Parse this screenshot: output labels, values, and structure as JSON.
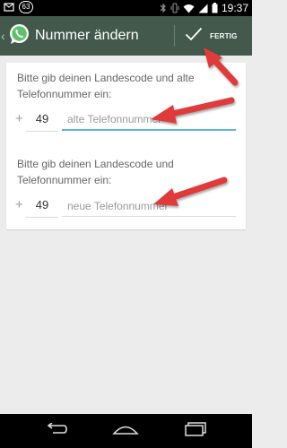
{
  "status_bar": {
    "notification_count": "63",
    "time": "19:37"
  },
  "action_bar": {
    "title": "Nummer ändern",
    "done_label": "FERTIG"
  },
  "form": {
    "old_number": {
      "instruction": "Bitte gib deinen Landescode und alte Telefonnummer ein:",
      "plus": "+",
      "country_code": "49",
      "placeholder": "alte Telefonnummer"
    },
    "new_number": {
      "instruction": "Bitte gib deinen Landescode und Telefonnummer ein:",
      "plus": "+",
      "country_code": "49",
      "placeholder": "neue Telefonnummer"
    }
  },
  "annotations": {
    "arrow_color": "#e03a3a"
  },
  "colors": {
    "action_bar": "#43594c",
    "focus_accent": "#5bb6d8"
  }
}
